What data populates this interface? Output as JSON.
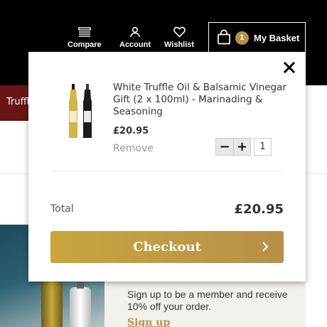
{
  "header": {
    "compare_label": "Compare",
    "account_label": "Account",
    "wishlist_label": "Wishlist",
    "basket_label": "My Basket",
    "basket_count": "1",
    "icons": [
      "compare-icon",
      "account-icon",
      "heart-icon",
      "bag-icon"
    ]
  },
  "background": {
    "nav_fragment": "Truffle",
    "promo_text": "Sign up to be a member and receive 10% off your order.",
    "signup_link": "Sign up"
  },
  "basket": {
    "item": {
      "name": "White Truffle Oil & Balsamic Vinegar Gift (2 x 100ml) - Marinading & Seasoning",
      "price": "£20.95",
      "remove_label": "Remove",
      "quantity": "1",
      "minus_label": "−",
      "plus_label": "+"
    },
    "total_label": "Total",
    "total_value": "£20.95",
    "checkout_label": "Checkout",
    "close_icon": "close-icon"
  },
  "colors": {
    "header_bg": "#000000",
    "accent_gold": "#c4a043",
    "count_badge": "#b8924a",
    "nav_red": "#6a1515"
  }
}
